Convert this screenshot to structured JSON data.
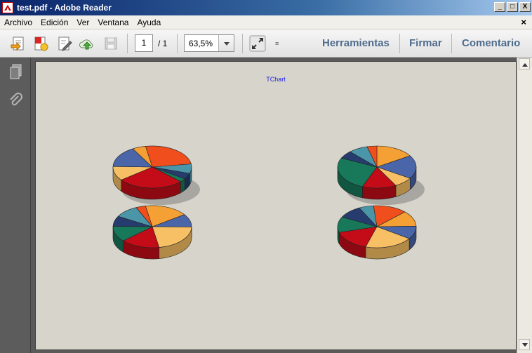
{
  "window": {
    "title": "test.pdf - Adobe Reader",
    "buttons": {
      "minimize": "_",
      "maximize": "□",
      "close": "X"
    }
  },
  "menu": {
    "items": [
      "Archivo",
      "Edición",
      "Ver",
      "Ventana",
      "Ayuda"
    ],
    "close_glyph": "×"
  },
  "toolbar": {
    "page_current": "1",
    "page_total": "/ 1",
    "zoom": "63,5%",
    "more_glyph": "≡",
    "links": [
      "Herramientas",
      "Firmar",
      "Comentario"
    ],
    "icons": [
      "open-icon",
      "create-pdf-icon",
      "edit-icon",
      "cloud-upload-icon",
      "save-icon",
      "fit-page-icon"
    ]
  },
  "leftnav": {
    "icons": [
      "pages-icon",
      "attachments-icon"
    ]
  },
  "document": {
    "title": "TChart",
    "palette": [
      "#4a65a8",
      "#f5a034",
      "#f04e1c",
      "#4a96a8",
      "#263c6e",
      "#18785a",
      "#c40c18",
      "#f7c064"
    ]
  }
}
